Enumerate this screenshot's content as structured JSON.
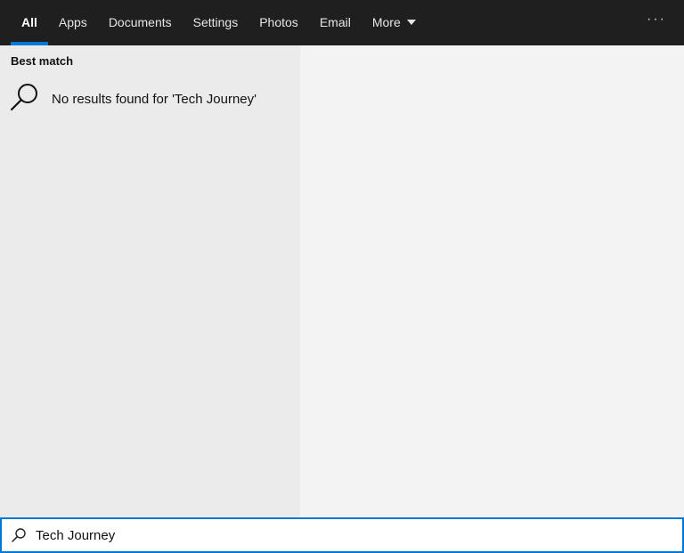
{
  "tabs": [
    {
      "label": "All",
      "active": true
    },
    {
      "label": "Apps"
    },
    {
      "label": "Documents"
    },
    {
      "label": "Settings"
    },
    {
      "label": "Photos"
    },
    {
      "label": "Email"
    },
    {
      "label": "More"
    }
  ],
  "more_options_icon": "ellipsis-icon",
  "results": {
    "section_title": "Best match",
    "message": "No results found for 'Tech Journey'",
    "icon": "search-icon"
  },
  "search": {
    "value": "Tech Journey",
    "icon": "search-icon"
  },
  "colors": {
    "accent": "#0078d7",
    "topbar": "#1f1f1f"
  }
}
